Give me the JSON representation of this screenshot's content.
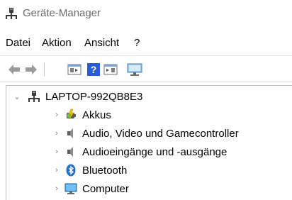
{
  "window": {
    "title": "Geräte-Manager"
  },
  "menu": {
    "items": [
      {
        "label": "Datei"
      },
      {
        "label": "Aktion"
      },
      {
        "label": "Ansicht"
      },
      {
        "label": "?"
      }
    ]
  },
  "toolbar": {
    "buttons": [
      {
        "icon": "back-arrow-icon"
      },
      {
        "icon": "forward-arrow-icon"
      },
      {
        "icon": "properties-window-icon"
      },
      {
        "icon": "help-icon"
      },
      {
        "icon": "update-driver-window-icon"
      },
      {
        "icon": "scan-hardware-monitor-icon"
      }
    ]
  },
  "tree": {
    "root": {
      "label": "LAPTOP-992QB8E3",
      "expanded": true,
      "icon": "computer-tower-icon"
    },
    "children": [
      {
        "label": "Akkus",
        "icon": "battery-icon",
        "expanded": false
      },
      {
        "label": "Audio, Video und Gamecontroller",
        "icon": "speaker-icon",
        "expanded": false
      },
      {
        "label": "Audioeingänge und -ausgänge",
        "icon": "speaker-icon",
        "expanded": false
      },
      {
        "label": "Bluetooth",
        "icon": "bluetooth-icon",
        "expanded": false
      },
      {
        "label": "Computer",
        "icon": "monitor-icon",
        "expanded": false
      }
    ]
  },
  "colors": {
    "title_text": "#6b6b6b",
    "bluetooth": "#1e6fd0",
    "help_blue": "#2a5bd7"
  }
}
